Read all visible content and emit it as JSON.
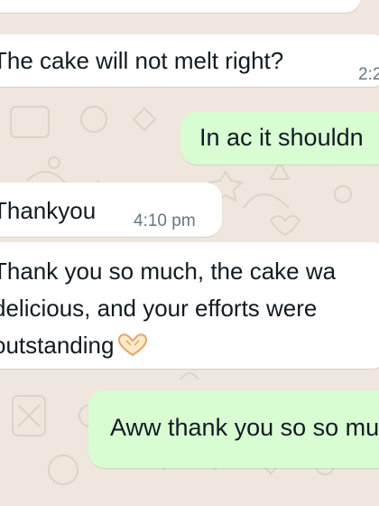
{
  "messages": [
    {
      "id": "m0",
      "direction": "incoming",
      "text": "",
      "time": ""
    },
    {
      "id": "m1",
      "direction": "incoming",
      "text": "The cake will not melt right?",
      "time": "2:2"
    },
    {
      "id": "m2",
      "direction": "outgoing",
      "text": "In ac it shouldn",
      "time": ""
    },
    {
      "id": "m3",
      "direction": "incoming",
      "text": "Thankyou",
      "time": "4:10 pm"
    },
    {
      "id": "m4",
      "direction": "incoming",
      "lines": [
        "Thank you so much, the cake wa",
        "delicious, and your efforts were",
        "outstanding"
      ],
      "emoji": "heart-hands-emoji",
      "time": ""
    },
    {
      "id": "m5",
      "direction": "outgoing",
      "text": "Aww thank you so so mu",
      "time": ""
    }
  ],
  "colors": {
    "wallpaper": "#efe7dd",
    "incoming_bubble": "#ffffff",
    "outgoing_bubble": "#d9fdd3",
    "text": "#111b21",
    "timestamp": "#667781"
  }
}
